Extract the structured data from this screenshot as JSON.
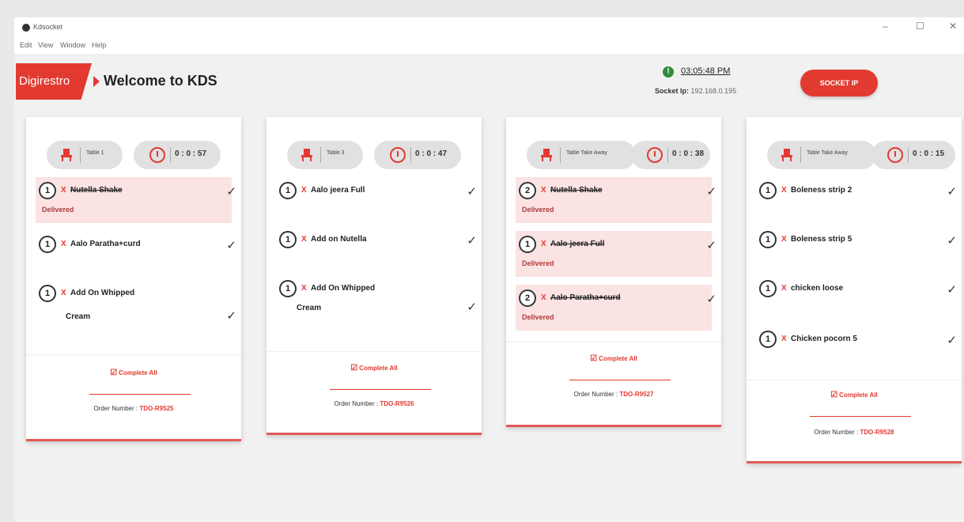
{
  "window": {
    "title": "Kdsocket",
    "controls": {
      "minimize": "–",
      "maximize": "☐",
      "close": "✕"
    },
    "menu": [
      "Edit",
      "View",
      "Window",
      "Help"
    ]
  },
  "header": {
    "logo": "Digirestro",
    "welcome": "Welcome to KDS",
    "status_icon": "!",
    "clock": "03:05:48 PM",
    "socket_label": "Socket Ip:",
    "socket_ip": "192.168.0.195",
    "socket_button": "SOCKET IP"
  },
  "cards": [
    {
      "table": "Table 1",
      "timer": "0 : 0 : 57",
      "items": [
        {
          "qty": "1",
          "x": "X",
          "name": "Nutella Shake",
          "status": "Delivered"
        },
        {
          "qty": "1",
          "x": "X",
          "name": "Aalo Paratha+curd"
        },
        {
          "qty": "1",
          "x": "X",
          "name": "Add On Whipped",
          "name2": "Cream"
        }
      ],
      "complete_all": "Complete All",
      "order_label": "Order Number :",
      "order_number": "TDO-R9525"
    },
    {
      "table": "Table 3",
      "timer": "0 : 0 : 47",
      "items": [
        {
          "qty": "1",
          "x": "X",
          "name": "Aalo jeera Full"
        },
        {
          "qty": "1",
          "x": "X",
          "name": "Add on Nutella"
        },
        {
          "qty": "1",
          "x": "X",
          "name": "Add On Whipped",
          "name2": "Cream"
        }
      ],
      "complete_all": "Complete All",
      "order_label": "Order Number :",
      "order_number": "TDO-R9526"
    },
    {
      "table": "Table Take Away",
      "timer": "0 : 0 : 38",
      "items": [
        {
          "qty": "2",
          "x": "X",
          "name": "Nutella Shake",
          "status": "Delivered"
        },
        {
          "qty": "1",
          "x": "X",
          "name": "Aalo jeera Full",
          "status": "Delivered"
        },
        {
          "qty": "2",
          "x": "X",
          "name": "Aalo Paratha+curd",
          "status": "Delivered"
        }
      ],
      "complete_all": "Complete All",
      "order_label": "Order Number :",
      "order_number": "TDO-R9527"
    },
    {
      "table": "Table Take Away",
      "timer": "0 : 0 : 15",
      "items": [
        {
          "qty": "1",
          "x": "X",
          "name": "Boleness strip 2"
        },
        {
          "qty": "1",
          "x": "X",
          "name": "Boleness strip 5"
        },
        {
          "qty": "1",
          "x": "X",
          "name": "chicken loose"
        },
        {
          "qty": "1",
          "x": "X",
          "name": "Chicken pocorn 5"
        }
      ],
      "complete_all": "Complete All",
      "order_label": "Order Number :",
      "order_number": "TDO-R9528"
    }
  ]
}
